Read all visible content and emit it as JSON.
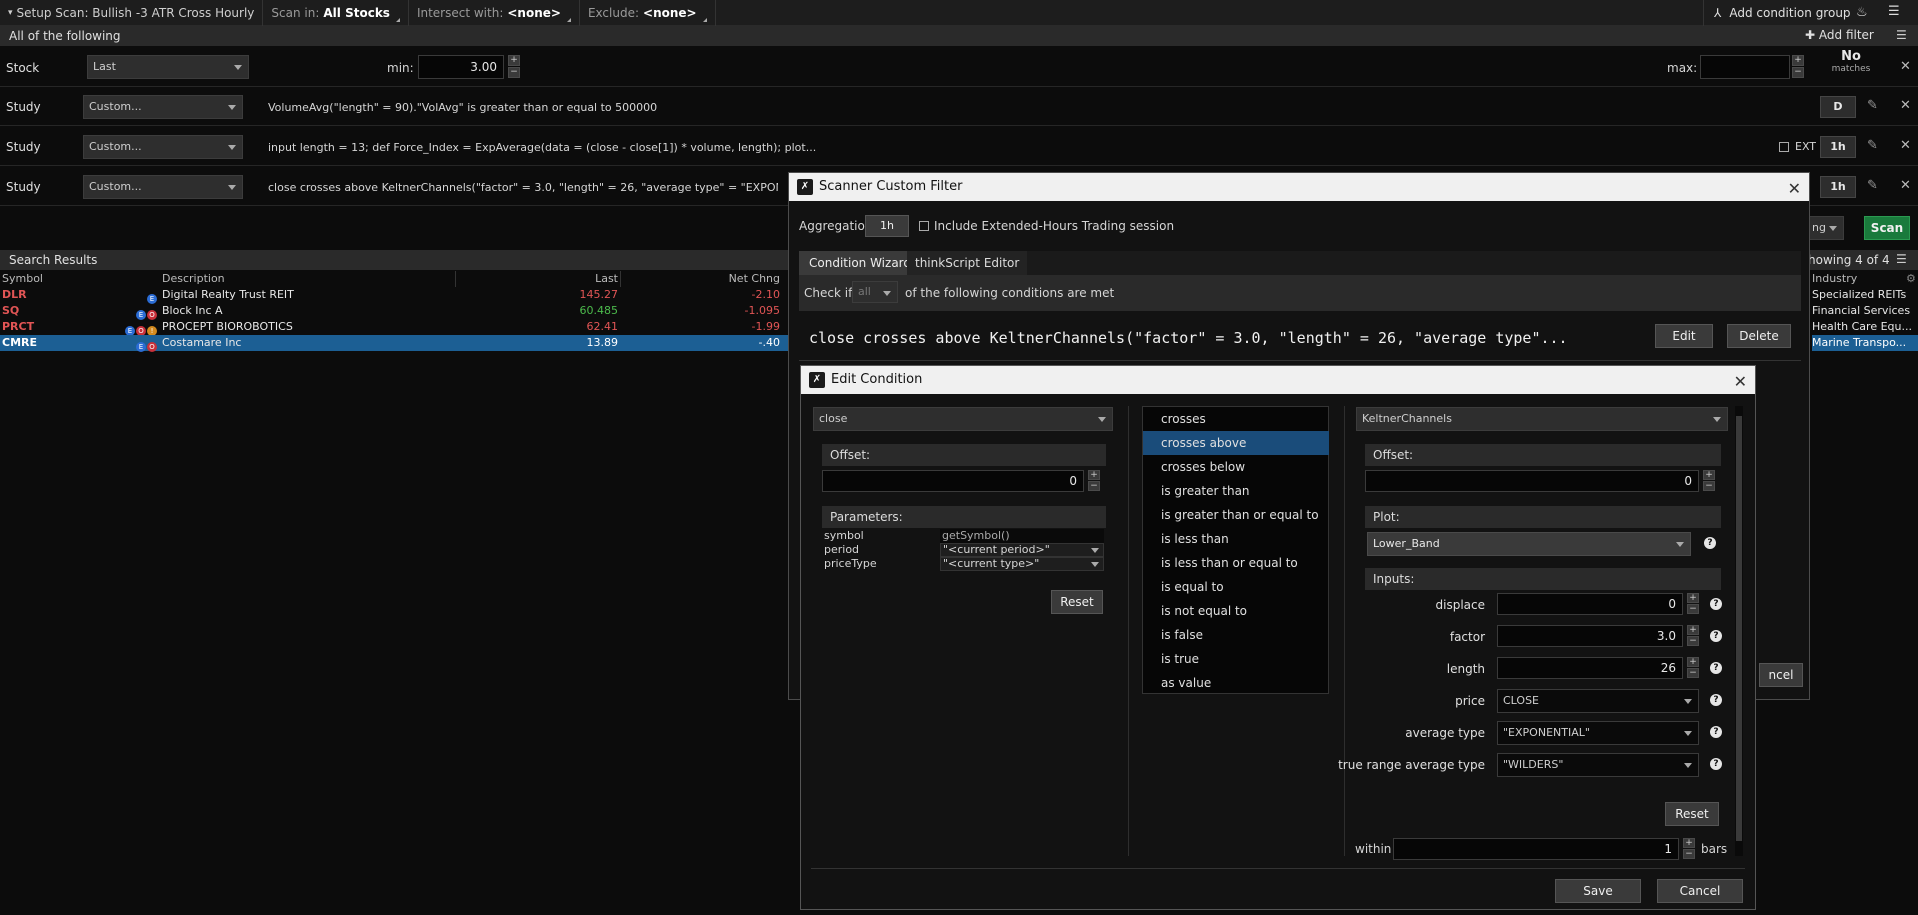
{
  "topbar": {
    "setup_scan": "Setup Scan: Bullish -3 ATR Cross Hourly",
    "scan_in_label": "Scan in:",
    "scan_in_value": "All Stocks",
    "intersect_label": "Intersect with:",
    "intersect_value": "<none>",
    "exclude_label": "Exclude:",
    "exclude_value": "<none>",
    "add_condition_group": "Add condition group"
  },
  "all_following": "All of the following",
  "add_filter": "Add filter",
  "filters": {
    "stock": {
      "label": "Stock",
      "combo": "Last",
      "min_label": "min:",
      "min_value": "3.00",
      "max_label": "max:",
      "max_value": "",
      "no_matches": "No",
      "matches": "matches"
    },
    "study1": {
      "label": "Study",
      "combo": "Custom...",
      "text": "VolumeAvg(\"length\" = 90).\"VolAvg\" is greater than or equal to 500000",
      "agg": "D"
    },
    "study2": {
      "label": "Study",
      "combo": "Custom...",
      "text": "input length = 13; def Force_Index = ExpAverage(data = (close - close[1]) * volume, length); plot...",
      "ext": "EXT",
      "agg": "1h"
    },
    "study3": {
      "label": "Study",
      "combo": "Custom...",
      "text": "close crosses above KeltnerChannels(\"factor\" = 3.0, \"length\" = 26, \"average type\" = \"EXPONENTIAL\"...",
      "agg": "1h"
    }
  },
  "scan_partial": "ng",
  "scan_button": "Scan",
  "showing": "howing 4 of 4",
  "search_results": {
    "title": "Search Results",
    "columns": {
      "symbol": "Symbol",
      "description": "Description",
      "last": "Last",
      "net_chng": "Net Chng",
      "industry": "Industry"
    },
    "rows": [
      {
        "symbol": "DLR",
        "description": "Digital Realty Trust REIT",
        "last": "145.27",
        "net": "-2.10",
        "industry": "Specialized REITs",
        "last_color": "#e15555"
      },
      {
        "symbol": "SQ",
        "description": "Block Inc A",
        "last": "60.485",
        "net": "-1.095",
        "industry": "Financial Services",
        "last_color": "#4cbb4c"
      },
      {
        "symbol": "PRCT",
        "description": "PROCEPT BIOROBOTICS",
        "last": "62.41",
        "net": "-1.99",
        "industry": "Health Care Equ...",
        "last_color": "#e15555"
      },
      {
        "symbol": "CMRE",
        "description": "Costamare Inc",
        "last": "13.89",
        "net": "-.40",
        "industry": "Marine Transpo...",
        "last_color": "#ffffff"
      }
    ]
  },
  "scf": {
    "title": "Scanner Custom Filter",
    "aggregation_label": "Aggregation:",
    "aggregation_value": "1h",
    "include_ext": "Include Extended-Hours Trading session",
    "tab_wizard": "Condition Wizard",
    "tab_editor": "thinkScript Editor",
    "check_if": "Check if",
    "check_if_value": "all",
    "of_following": "of the following conditions are met",
    "condition_text": "close crosses above KeltnerChannels(\"factor\" = 3.0, \"length\" = 26, \"average type\"...",
    "edit": "Edit",
    "delete": "Delete",
    "cancel_partial": "ncel"
  },
  "ec": {
    "title": "Edit Condition",
    "left": {
      "combo": "close",
      "offset_label": "Offset:",
      "offset_value": "0",
      "parameters_label": "Parameters:",
      "params": [
        {
          "name": "symbol",
          "value": "getSymbol()"
        },
        {
          "name": "period",
          "value": "\"<current period>\""
        },
        {
          "name": "priceType",
          "value": "\"<current type>\""
        }
      ],
      "reset": "Reset"
    },
    "operators": [
      "crosses",
      "crosses above",
      "crosses below",
      "is greater than",
      "is greater than or equal to",
      "is less than",
      "is less than or equal to",
      "is equal to",
      "is not equal to",
      "is false",
      "is true",
      "as value"
    ],
    "right": {
      "combo": "KeltnerChannels",
      "offset_label": "Offset:",
      "offset_value": "0",
      "plot_label": "Plot:",
      "plot_value": "Lower_Band",
      "inputs_label": "Inputs:",
      "inputs": {
        "displace_label": "displace",
        "displace": "0",
        "factor_label": "factor",
        "factor": "3.0",
        "length_label": "length",
        "length": "26",
        "price_label": "price",
        "price": "CLOSE",
        "avg_type_label": "average type",
        "avg_type": "\"EXPONENTIAL\"",
        "tr_avg_type_label": "true range average type",
        "tr_avg_type": "\"WILDERS\""
      },
      "reset": "Reset"
    },
    "within_label": "within",
    "within_value": "1",
    "bars_label": "bars",
    "save": "Save",
    "cancel": "Cancel"
  }
}
